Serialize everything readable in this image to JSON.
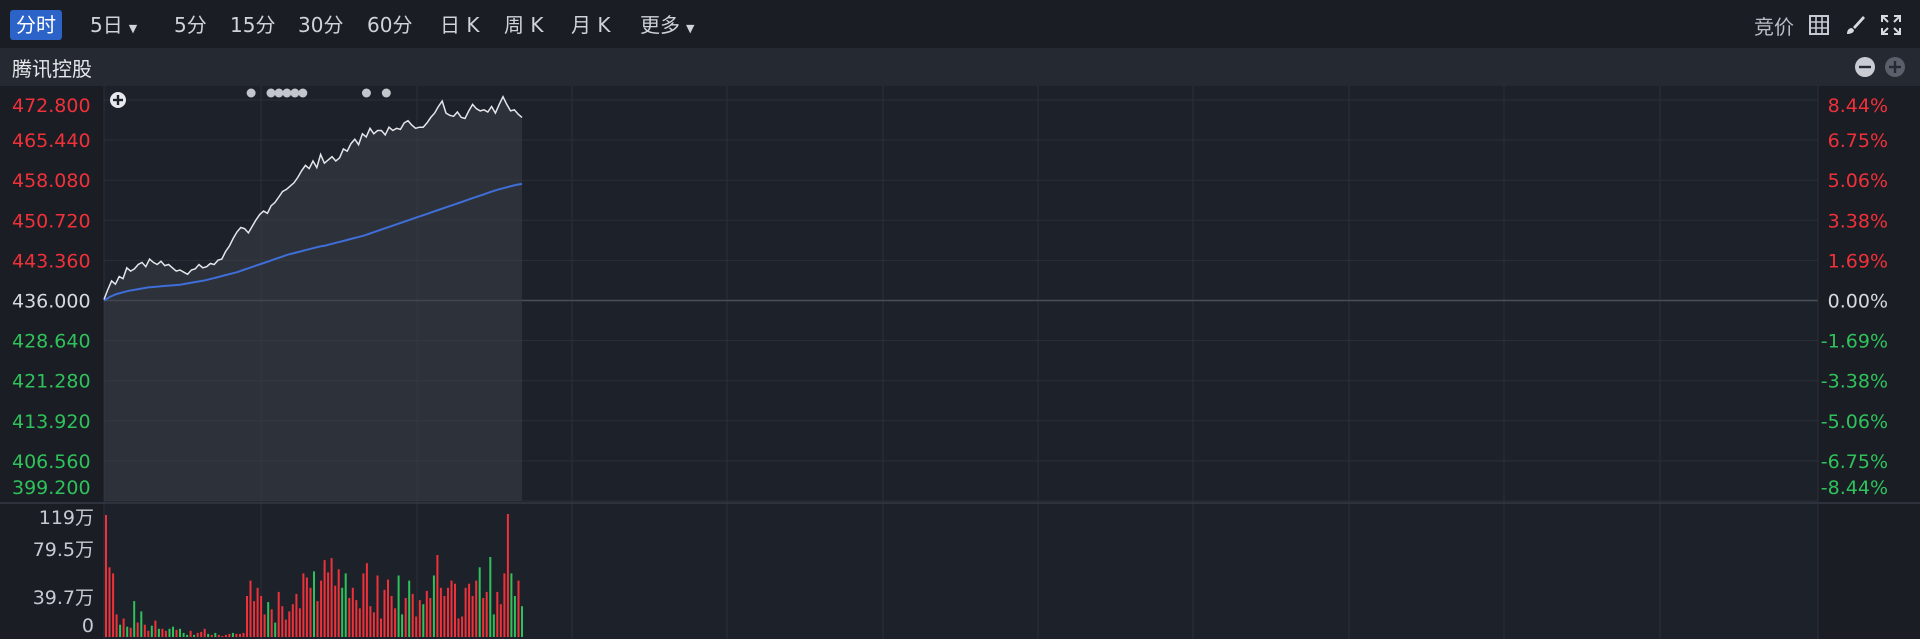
{
  "toolbar": {
    "tabs": [
      {
        "label": "分时",
        "active": true,
        "dropdown": false
      },
      {
        "label": "5日",
        "active": false,
        "dropdown": true
      },
      {
        "label": "5分",
        "active": false,
        "dropdown": false
      },
      {
        "label": "15分",
        "active": false,
        "dropdown": false
      },
      {
        "label": "30分",
        "active": false,
        "dropdown": false
      },
      {
        "label": "60分",
        "active": false,
        "dropdown": false
      },
      {
        "label": "日 K",
        "active": false,
        "dropdown": false
      },
      {
        "label": "周 K",
        "active": false,
        "dropdown": false
      },
      {
        "label": "月 K",
        "active": false,
        "dropdown": false
      },
      {
        "label": "更多",
        "active": false,
        "dropdown": true
      }
    ],
    "auction_label": "竞价",
    "icons": [
      "grid-layout-icon",
      "brush-icon",
      "fullscreen-icon"
    ]
  },
  "panel": {
    "title": "腾讯控股",
    "icons": [
      "collapse-minus-icon",
      "expand-plus-icon"
    ],
    "add_indicator_icon": "add-indicator-icon"
  },
  "colors": {
    "up": "#f0313a",
    "down": "#2fc25b",
    "neutral": "#d6d9df",
    "price_line": "#e4e6ea",
    "avg_line": "#3f6ed8",
    "active_tab": "#2b63c9"
  },
  "chart_data": {
    "type": "line",
    "prev_close": 436.0,
    "price_axis_ticks": [
      "472.800",
      "465.440",
      "458.080",
      "450.720",
      "443.360",
      "436.000",
      "428.640",
      "421.280",
      "413.920",
      "406.560",
      "399.200"
    ],
    "pct_axis_ticks": [
      "8.44%",
      "6.75%",
      "5.06%",
      "3.38%",
      "1.69%",
      "0.00%",
      "-1.69%",
      "-3.38%",
      "-5.06%",
      "-6.75%",
      "-8.44%"
    ],
    "ylim": [
      399.2,
      472.8
    ],
    "x_max": 330,
    "price": [
      436.2,
      438.0,
      439.6,
      439.0,
      440.4,
      440.0,
      442.0,
      441.4,
      441.8,
      442.6,
      443.0,
      442.2,
      443.6,
      443.0,
      442.6,
      443.2,
      442.4,
      442.6,
      442.0,
      441.4,
      441.6,
      441.2,
      440.8,
      441.6,
      441.8,
      442.6,
      442.0,
      442.2,
      442.8,
      442.6,
      443.4,
      443.6,
      445.0,
      446.0,
      447.4,
      448.6,
      449.4,
      449.2,
      448.4,
      449.6,
      450.8,
      451.8,
      452.4,
      452.0,
      453.4,
      454.0,
      455.0,
      456.0,
      456.4,
      457.0,
      457.6,
      458.6,
      459.8,
      460.8,
      460.2,
      461.6,
      460.4,
      462.8,
      461.2,
      461.8,
      462.4,
      461.6,
      462.2,
      463.8,
      463.4,
      464.8,
      465.6,
      464.6,
      466.6,
      466.0,
      467.6,
      466.6,
      467.2,
      467.2,
      466.4,
      467.8,
      467.2,
      467.6,
      467.4,
      468.6,
      469.0,
      468.2,
      467.6,
      467.8,
      467.8,
      468.6,
      469.6,
      470.4,
      471.6,
      472.6,
      470.4,
      470.0,
      469.8,
      470.6,
      469.6,
      469.4,
      470.8,
      472.0,
      471.2,
      470.8,
      471.0,
      470.6,
      471.6,
      470.4,
      472.0,
      473.4,
      472.0,
      470.8,
      471.0,
      470.2,
      469.6
    ],
    "avg": [
      436.0,
      436.7,
      437.2,
      437.5,
      437.8,
      438.0,
      438.2,
      438.4,
      438.5,
      438.6,
      438.7,
      438.8,
      438.9,
      439.1,
      439.3,
      439.5,
      439.7,
      440.0,
      440.3,
      440.6,
      440.9,
      441.2,
      441.6,
      442.0,
      442.4,
      442.8,
      443.2,
      443.6,
      444.0,
      444.4,
      444.7,
      445.0,
      445.3,
      445.6,
      445.9,
      446.1,
      446.4,
      446.7,
      447.0,
      447.3,
      447.6,
      447.9,
      448.3,
      448.7,
      449.1,
      449.5,
      449.9,
      450.3,
      450.7,
      451.1,
      451.5,
      451.9,
      452.3,
      452.7,
      453.1,
      453.5,
      453.9,
      454.3,
      454.7,
      455.1,
      455.5,
      455.9,
      456.3,
      456.6,
      456.9,
      457.2,
      457.4
    ],
    "volume_axis_ticks": [
      "119万",
      "79.5万",
      "39.7万",
      "0"
    ],
    "volume_max": 119,
    "volumes": [
      {
        "v": 119,
        "up": true
      },
      {
        "v": 68,
        "up": true
      },
      {
        "v": 62,
        "up": true
      },
      {
        "v": 22,
        "up": true
      },
      {
        "v": 12,
        "up": false
      },
      {
        "v": 18,
        "up": true
      },
      {
        "v": 10,
        "up": false
      },
      {
        "v": 9,
        "up": true
      },
      {
        "v": 35,
        "up": false
      },
      {
        "v": 14,
        "up": true
      },
      {
        "v": 25,
        "up": false
      },
      {
        "v": 12,
        "up": true
      },
      {
        "v": 6,
        "up": true
      },
      {
        "v": 11,
        "up": false
      },
      {
        "v": 16,
        "up": true
      },
      {
        "v": 8,
        "up": false
      },
      {
        "v": 8,
        "up": true
      },
      {
        "v": 6,
        "up": true
      },
      {
        "v": 8,
        "up": false
      },
      {
        "v": 10,
        "up": false
      },
      {
        "v": 7,
        "up": true
      },
      {
        "v": 8,
        "up": false
      },
      {
        "v": 4,
        "up": false
      },
      {
        "v": 2,
        "up": false
      },
      {
        "v": 6,
        "up": true
      },
      {
        "v": 2,
        "up": false
      },
      {
        "v": 4,
        "up": true
      },
      {
        "v": 5,
        "up": true
      },
      {
        "v": 8,
        "up": true
      },
      {
        "v": 3,
        "up": false
      },
      {
        "v": 2,
        "up": true
      },
      {
        "v": 4,
        "up": false
      },
      {
        "v": 2,
        "up": true
      },
      {
        "v": 1,
        "up": true
      },
      {
        "v": 2,
        "up": true
      },
      {
        "v": 3,
        "up": true
      },
      {
        "v": 4,
        "up": false
      },
      {
        "v": 3,
        "up": true
      },
      {
        "v": 3,
        "up": true
      },
      {
        "v": 4,
        "up": true
      },
      {
        "v": 40,
        "up": true
      },
      {
        "v": 55,
        "up": true
      },
      {
        "v": 35,
        "up": true
      },
      {
        "v": 48,
        "up": true
      },
      {
        "v": 40,
        "up": true
      },
      {
        "v": 22,
        "up": true
      },
      {
        "v": 34,
        "up": false
      },
      {
        "v": 27,
        "up": true
      },
      {
        "v": 14,
        "up": false
      },
      {
        "v": 44,
        "up": true
      },
      {
        "v": 30,
        "up": true
      },
      {
        "v": 17,
        "up": true
      },
      {
        "v": 25,
        "up": true
      },
      {
        "v": 32,
        "up": true
      },
      {
        "v": 42,
        "up": true
      },
      {
        "v": 28,
        "up": true
      },
      {
        "v": 62,
        "up": true
      },
      {
        "v": 58,
        "up": true
      },
      {
        "v": 48,
        "up": true
      },
      {
        "v": 64,
        "up": false
      },
      {
        "v": 35,
        "up": true
      },
      {
        "v": 55,
        "up": true
      },
      {
        "v": 75,
        "up": true
      },
      {
        "v": 63,
        "up": true
      },
      {
        "v": 77,
        "up": true
      },
      {
        "v": 50,
        "up": true
      },
      {
        "v": 66,
        "up": true
      },
      {
        "v": 48,
        "up": false
      },
      {
        "v": 62,
        "up": false
      },
      {
        "v": 38,
        "up": true
      },
      {
        "v": 48,
        "up": true
      },
      {
        "v": 36,
        "up": true
      },
      {
        "v": 28,
        "up": true
      },
      {
        "v": 62,
        "up": true
      },
      {
        "v": 72,
        "up": true
      },
      {
        "v": 30,
        "up": true
      },
      {
        "v": 24,
        "up": true
      },
      {
        "v": 60,
        "up": true
      },
      {
        "v": 18,
        "up": true
      },
      {
        "v": 46,
        "up": true
      },
      {
        "v": 56,
        "up": true
      },
      {
        "v": 40,
        "up": true
      },
      {
        "v": 28,
        "up": true
      },
      {
        "v": 60,
        "up": false
      },
      {
        "v": 22,
        "up": false
      },
      {
        "v": 38,
        "up": true
      },
      {
        "v": 55,
        "up": false
      },
      {
        "v": 42,
        "up": true
      },
      {
        "v": 20,
        "up": true
      },
      {
        "v": 36,
        "up": true
      },
      {
        "v": 32,
        "up": false
      },
      {
        "v": 45,
        "up": true
      },
      {
        "v": 38,
        "up": true
      },
      {
        "v": 60,
        "up": false
      },
      {
        "v": 80,
        "up": true
      },
      {
        "v": 48,
        "up": true
      },
      {
        "v": 40,
        "up": true
      },
      {
        "v": 48,
        "up": true
      },
      {
        "v": 55,
        "up": true
      },
      {
        "v": 52,
        "up": true
      },
      {
        "v": 18,
        "up": true
      },
      {
        "v": 20,
        "up": true
      },
      {
        "v": 48,
        "up": true
      },
      {
        "v": 52,
        "up": true
      },
      {
        "v": 40,
        "up": true
      },
      {
        "v": 55,
        "up": true
      },
      {
        "v": 68,
        "up": false
      },
      {
        "v": 38,
        "up": true
      },
      {
        "v": 44,
        "up": true
      },
      {
        "v": 78,
        "up": false
      },
      {
        "v": 22,
        "up": false
      },
      {
        "v": 44,
        "up": true
      },
      {
        "v": 32,
        "up": true
      },
      {
        "v": 62,
        "up": true
      },
      {
        "v": 120,
        "up": true
      },
      {
        "v": 62,
        "up": false
      },
      {
        "v": 40,
        "up": false
      },
      {
        "v": 55,
        "up": true
      },
      {
        "v": 30,
        "up": false
      }
    ],
    "grid": true,
    "event_dots": [
      0.37,
      0.42,
      0.44,
      0.46,
      0.48,
      0.5,
      0.66,
      0.71
    ]
  }
}
